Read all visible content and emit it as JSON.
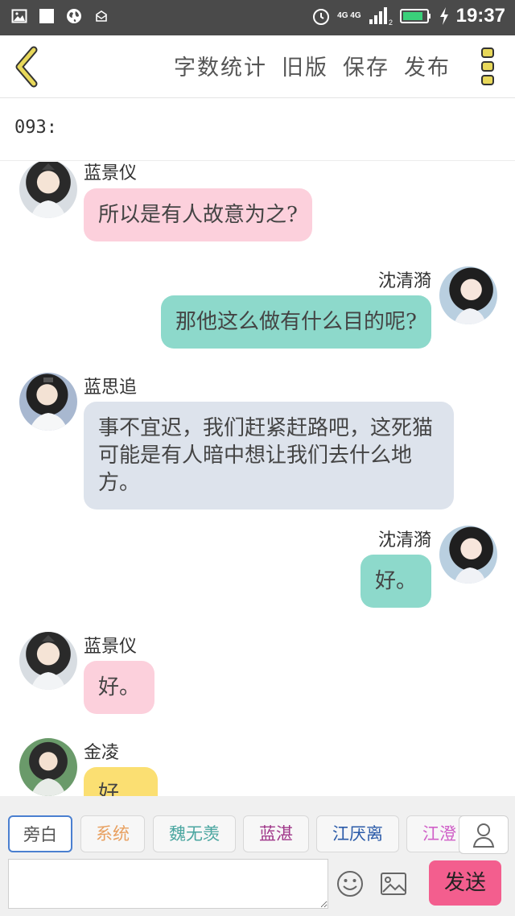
{
  "status_bar": {
    "time": "19:37",
    "network": "4G 4G",
    "sim_index": "2",
    "icons": [
      "image-icon",
      "square-icon",
      "globe-icon",
      "mail-icon",
      "alarm-icon",
      "signal-icon",
      "battery-icon",
      "charging-icon"
    ]
  },
  "toolbar": {
    "back_icon": "chevron-left-icon",
    "word_count": "字数统计",
    "old_version": "旧版",
    "save": "保存",
    "publish": "发布",
    "menu_icon": "more-vertical-icon",
    "accent": "#e8d85a"
  },
  "chapter": {
    "title": "093:"
  },
  "messages": [
    {
      "side": "left",
      "name": "蓝景仪",
      "text": "所以是有人故意为之?",
      "bubble_color": "#fcd0dc"
    },
    {
      "side": "right",
      "name": "沈清漪",
      "text": "那他这么做有什么目的呢?",
      "bubble_color": "#8dd9cb"
    },
    {
      "side": "left",
      "name": "蓝思追",
      "text": "事不宜迟，我们赶紧赶路吧，这死猫可能是有人暗中想让我们去什么地方。",
      "bubble_color": "#dde3ec"
    },
    {
      "side": "right",
      "name": "沈清漪",
      "text": "好。",
      "bubble_color": "#8dd9cb"
    },
    {
      "side": "left",
      "name": "蓝景仪",
      "text": "好。",
      "bubble_color": "#fcd0dc"
    },
    {
      "side": "left",
      "name": "金凌",
      "text": "好",
      "bubble_color": "#fbdf72"
    }
  ],
  "roles": [
    {
      "label": "旁白",
      "color": "#555555",
      "active": true
    },
    {
      "label": "系统",
      "color": "#e8a060",
      "active": false
    },
    {
      "label": "魏无羡",
      "color": "#4aa6a0",
      "active": false
    },
    {
      "label": "蓝湛",
      "color": "#a0388a",
      "active": false
    },
    {
      "label": "江厌离",
      "color": "#2a5aa8",
      "active": false
    },
    {
      "label": "江澄",
      "color": "#d060c8",
      "active": false
    }
  ],
  "composer": {
    "input_value": "",
    "user_icon": "user-icon",
    "emoji_icon": "smiley-icon",
    "image_icon": "picture-icon",
    "send": "发送",
    "send_color": "#f35e8e"
  }
}
